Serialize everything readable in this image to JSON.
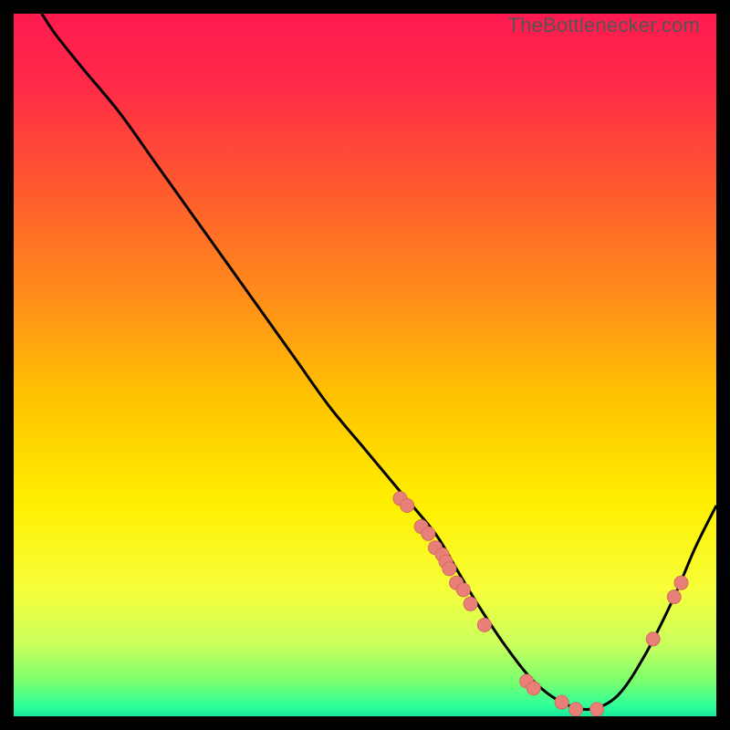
{
  "watermark": "TheBottlenecker.com",
  "colors": {
    "gradient_stops": [
      {
        "offset": 0.0,
        "color": "#ff1a4f"
      },
      {
        "offset": 0.1,
        "color": "#ff2a48"
      },
      {
        "offset": 0.25,
        "color": "#ff5a2e"
      },
      {
        "offset": 0.4,
        "color": "#ff8c1a"
      },
      {
        "offset": 0.55,
        "color": "#ffc400"
      },
      {
        "offset": 0.7,
        "color": "#fff000"
      },
      {
        "offset": 0.82,
        "color": "#f6ff3a"
      },
      {
        "offset": 0.9,
        "color": "#c8ff5e"
      },
      {
        "offset": 0.95,
        "color": "#7aff6e"
      },
      {
        "offset": 0.985,
        "color": "#2eff9a"
      },
      {
        "offset": 1.0,
        "color": "#18e89a"
      }
    ],
    "curve": "#000000",
    "dot_fill": "#e98078",
    "dot_stroke": "#d46a62"
  },
  "chart_data": {
    "type": "line",
    "title": "",
    "xlabel": "",
    "ylabel": "",
    "xlim": [
      0,
      100
    ],
    "ylim": [
      0,
      100
    ],
    "series": [
      {
        "name": "bottleneck-curve",
        "x": [
          4,
          6,
          10,
          15,
          20,
          25,
          30,
          35,
          40,
          45,
          50,
          55,
          60,
          63,
          66,
          70,
          74,
          78,
          82,
          86,
          90,
          94,
          97,
          100
        ],
        "y": [
          100,
          97,
          92,
          86,
          79,
          72,
          65,
          58,
          51,
          44,
          38,
          32,
          26,
          21,
          16,
          10,
          5,
          2,
          1,
          3,
          9,
          17,
          24,
          30
        ]
      }
    ],
    "points": [
      {
        "name": "dot",
        "x": 55,
        "y": 31
      },
      {
        "name": "dot",
        "x": 56,
        "y": 30
      },
      {
        "name": "dot",
        "x": 58,
        "y": 27
      },
      {
        "name": "dot",
        "x": 59,
        "y": 26
      },
      {
        "name": "dot",
        "x": 60,
        "y": 24
      },
      {
        "name": "dot",
        "x": 61,
        "y": 23
      },
      {
        "name": "dot",
        "x": 61.5,
        "y": 22
      },
      {
        "name": "dot",
        "x": 62,
        "y": 21
      },
      {
        "name": "dot",
        "x": 63,
        "y": 19
      },
      {
        "name": "dot",
        "x": 64,
        "y": 18
      },
      {
        "name": "dot",
        "x": 65,
        "y": 16
      },
      {
        "name": "dot",
        "x": 67,
        "y": 13
      },
      {
        "name": "dot",
        "x": 73,
        "y": 5
      },
      {
        "name": "dot",
        "x": 74,
        "y": 4
      },
      {
        "name": "dot",
        "x": 78,
        "y": 2
      },
      {
        "name": "dot",
        "x": 80,
        "y": 1
      },
      {
        "name": "dot",
        "x": 83,
        "y": 1
      },
      {
        "name": "dot",
        "x": 91,
        "y": 11
      },
      {
        "name": "dot",
        "x": 94,
        "y": 17
      },
      {
        "name": "dot",
        "x": 95,
        "y": 19
      }
    ]
  }
}
